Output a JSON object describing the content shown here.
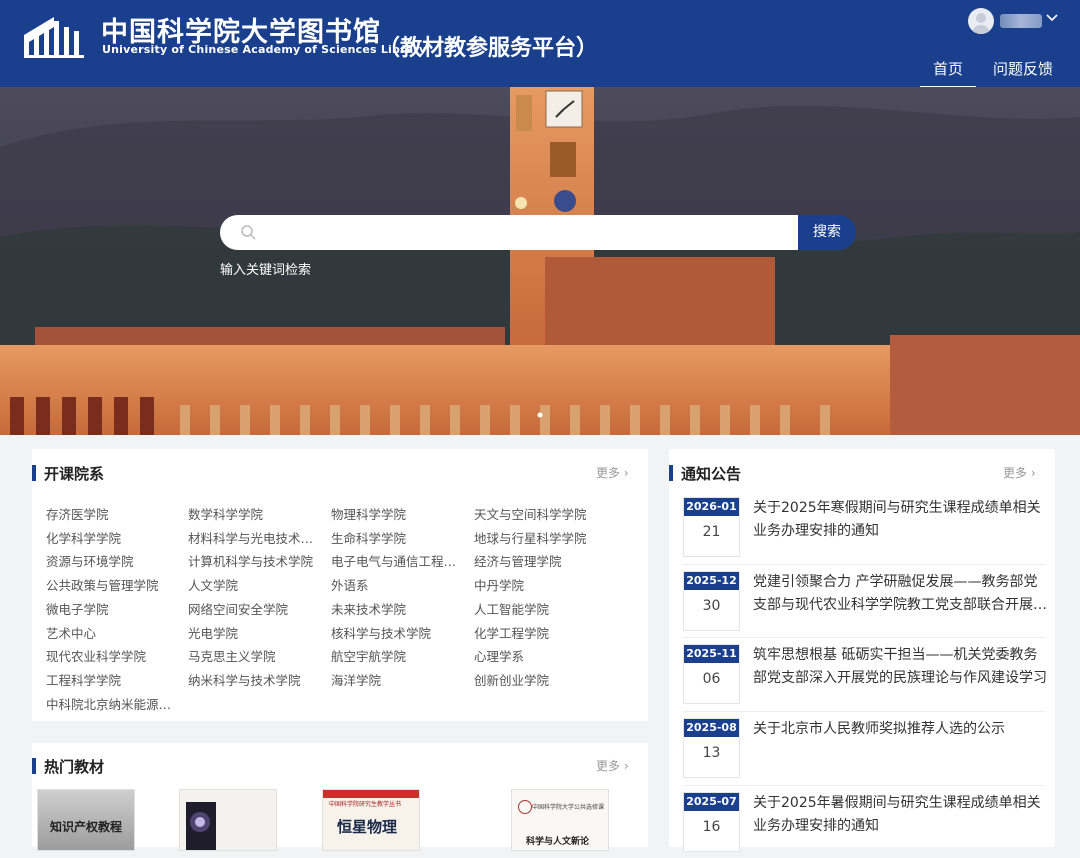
{
  "header": {
    "library_cn": "中国科学院大学图书馆",
    "library_en": "University of Chinese Academy of Sciences Library",
    "platform": "（教材教参服务平台）",
    "nav": {
      "home": "首页",
      "feedback": "问题反馈"
    }
  },
  "search": {
    "button_label": "搜索",
    "hint": "输入关键词检索",
    "placeholder": ""
  },
  "colleges": {
    "title": "开课院系",
    "more": "更多 ›",
    "items": [
      "存济医学院",
      "数学科学学院",
      "物理科学学院",
      "天文与空间科学学院",
      "化学科学学院",
      "材料科学与光电技术学院",
      "生命科学学院",
      "地球与行星科学学院",
      "资源与环境学院",
      "计算机科学与技术学院",
      "电子电气与通信工程学院",
      "经济与管理学院",
      "公共政策与管理学院",
      "人文学院",
      "外语系",
      "中丹学院",
      "微电子学院",
      "网络空间安全学院",
      "未来技术学院",
      "人工智能学院",
      "艺术中心",
      "光电学院",
      "核科学与技术学院",
      "化学工程学院",
      "现代农业科学学院",
      "马克思主义学院",
      "航空宇航学院",
      "心理学系",
      "工程科学学院",
      "纳米科学与技术学院",
      "海洋学院",
      "创新创业学院",
      "中科院北京纳米能源与系统研究所"
    ]
  },
  "textbooks": {
    "title": "热门教材",
    "more": "更多 ›",
    "books": [
      {
        "title": "知识产权教程"
      },
      {
        "title": ""
      },
      {
        "title": "恒星物理",
        "series": "中国科学院研究生教学丛书"
      },
      {
        "title": "科学与人文新论",
        "series": "中国科学院大学公共选修课教材"
      }
    ]
  },
  "notices": {
    "title": "通知公告",
    "more": "更多 ›",
    "items": [
      {
        "ym": "2026-01",
        "d": "21",
        "text": "关于2025年寒假期间与研究生课程成绩单相关业务办理安排的通知"
      },
      {
        "ym": "2025-12",
        "d": "30",
        "text": "党建引领聚合力 产学研融促发展——教务部党支部与现代农业科学学院教工党支部联合开展主题党日活动"
      },
      {
        "ym": "2025-11",
        "d": "06",
        "text": "筑牢思想根基 砥砺实干担当——机关党委教务部党支部深入开展党的民族理论与作风建设学习"
      },
      {
        "ym": "2025-08",
        "d": "13",
        "text": "关于北京市人民教师奖拟推荐人选的公示"
      },
      {
        "ym": "2025-07",
        "d": "16",
        "text": "关于2025年暑假期间与研究生课程成绩单相关业务办理安排的通知"
      }
    ]
  },
  "colors": {
    "brand": "#1a3f8c"
  }
}
